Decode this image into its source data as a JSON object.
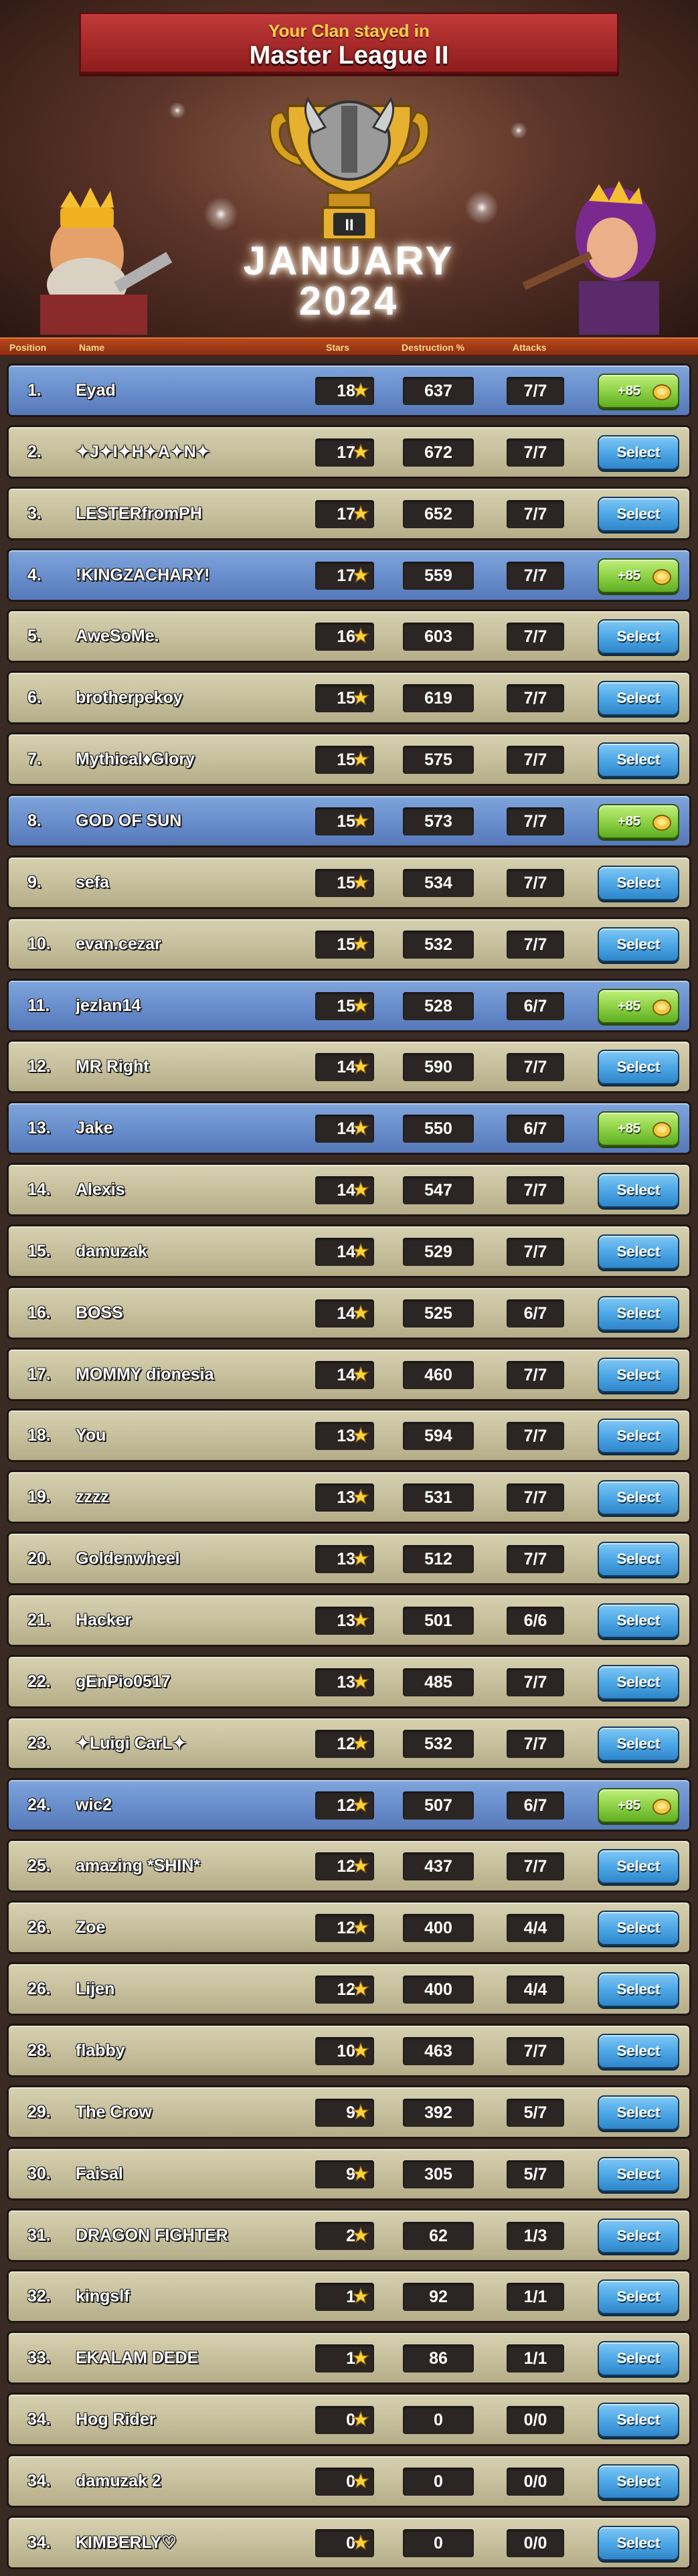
{
  "banner": {
    "subtitle": "Your Clan stayed in",
    "title": "Master League II"
  },
  "trophy": {
    "level": "II"
  },
  "season": {
    "month": "JANUARY",
    "year": "2024"
  },
  "columns": {
    "position": "Position",
    "name": "Name",
    "stars": "Stars",
    "destruction": "Destruction %",
    "attacks": "Attacks"
  },
  "colors": {
    "clan_row": "#6a8fcd",
    "other_row": "#c7c09d",
    "select_button": "#4ea8e6",
    "bonus_button": "#8fd247"
  },
  "buttons": {
    "select": "Select",
    "bonus": "+85"
  },
  "rows": [
    {
      "pos": "1.",
      "name": "Eyad",
      "stars": "18",
      "destruction": "637",
      "attacks": "7/7",
      "clan": true
    },
    {
      "pos": "2.",
      "name": "✦J✦I✦H✦A✦N✦",
      "stars": "17",
      "destruction": "672",
      "attacks": "7/7",
      "clan": false
    },
    {
      "pos": "3.",
      "name": "LESTERfromPH",
      "stars": "17",
      "destruction": "652",
      "attacks": "7/7",
      "clan": false
    },
    {
      "pos": "4.",
      "name": "!KINGZACHARY!",
      "stars": "17",
      "destruction": "559",
      "attacks": "7/7",
      "clan": true
    },
    {
      "pos": "5.",
      "name": "AweSoMe.",
      "stars": "16",
      "destruction": "603",
      "attacks": "7/7",
      "clan": false
    },
    {
      "pos": "6.",
      "name": "brotherpekoy",
      "stars": "15",
      "destruction": "619",
      "attacks": "7/7",
      "clan": false
    },
    {
      "pos": "7.",
      "name": "Mythical♦Glory",
      "stars": "15",
      "destruction": "575",
      "attacks": "7/7",
      "clan": false
    },
    {
      "pos": "8.",
      "name": "GOD OF SUN",
      "stars": "15",
      "destruction": "573",
      "attacks": "7/7",
      "clan": true
    },
    {
      "pos": "9.",
      "name": "sefa",
      "stars": "15",
      "destruction": "534",
      "attacks": "7/7",
      "clan": false
    },
    {
      "pos": "10.",
      "name": "evan.cezar",
      "stars": "15",
      "destruction": "532",
      "attacks": "7/7",
      "clan": false
    },
    {
      "pos": "11.",
      "name": "jezlan14",
      "stars": "15",
      "destruction": "528",
      "attacks": "6/7",
      "clan": true
    },
    {
      "pos": "12.",
      "name": "MR Right",
      "stars": "14",
      "destruction": "590",
      "attacks": "7/7",
      "clan": false
    },
    {
      "pos": "13.",
      "name": "Jake",
      "stars": "14",
      "destruction": "550",
      "attacks": "6/7",
      "clan": true
    },
    {
      "pos": "14.",
      "name": "Alexis",
      "stars": "14",
      "destruction": "547",
      "attacks": "7/7",
      "clan": false
    },
    {
      "pos": "15.",
      "name": "damuzak",
      "stars": "14",
      "destruction": "529",
      "attacks": "7/7",
      "clan": false
    },
    {
      "pos": "16.",
      "name": "BOSS",
      "stars": "14",
      "destruction": "525",
      "attacks": "6/7",
      "clan": false
    },
    {
      "pos": "17.",
      "name": "MOMMY dionesia",
      "stars": "14",
      "destruction": "460",
      "attacks": "7/7",
      "clan": false
    },
    {
      "pos": "18.",
      "name": "You",
      "stars": "13",
      "destruction": "594",
      "attacks": "7/7",
      "clan": false
    },
    {
      "pos": "19.",
      "name": "zzzz",
      "stars": "13",
      "destruction": "531",
      "attacks": "7/7",
      "clan": false
    },
    {
      "pos": "20.",
      "name": "Goldenwheel",
      "stars": "13",
      "destruction": "512",
      "attacks": "7/7",
      "clan": false
    },
    {
      "pos": "21.",
      "name": "Hacker",
      "stars": "13",
      "destruction": "501",
      "attacks": "6/6",
      "clan": false
    },
    {
      "pos": "22.",
      "name": "gEnPio0517",
      "stars": "13",
      "destruction": "485",
      "attacks": "7/7",
      "clan": false
    },
    {
      "pos": "23.",
      "name": "✦Luigi CarL✦",
      "stars": "12",
      "destruction": "532",
      "attacks": "7/7",
      "clan": false
    },
    {
      "pos": "24.",
      "name": "wic2",
      "stars": "12",
      "destruction": "507",
      "attacks": "6/7",
      "clan": true
    },
    {
      "pos": "25.",
      "name": "amazing *SHIN*",
      "stars": "12",
      "destruction": "437",
      "attacks": "7/7",
      "clan": false
    },
    {
      "pos": "26.",
      "name": "Zoe",
      "stars": "12",
      "destruction": "400",
      "attacks": "4/4",
      "clan": false
    },
    {
      "pos": "26.",
      "name": "Lijen",
      "stars": "12",
      "destruction": "400",
      "attacks": "4/4",
      "clan": false
    },
    {
      "pos": "28.",
      "name": "flabby",
      "stars": "10",
      "destruction": "463",
      "attacks": "7/7",
      "clan": false
    },
    {
      "pos": "29.",
      "name": "The Crow",
      "stars": "9",
      "destruction": "392",
      "attacks": "5/7",
      "clan": false
    },
    {
      "pos": "30.",
      "name": "Faisal",
      "stars": "9",
      "destruction": "305",
      "attacks": "5/7",
      "clan": false
    },
    {
      "pos": "31.",
      "name": "DRAGON FIGHTER",
      "stars": "2",
      "destruction": "62",
      "attacks": "1/3",
      "clan": false
    },
    {
      "pos": "32.",
      "name": "kingslf",
      "stars": "1",
      "destruction": "92",
      "attacks": "1/1",
      "clan": false
    },
    {
      "pos": "33.",
      "name": "EKALAM DEDE",
      "stars": "1",
      "destruction": "86",
      "attacks": "1/1",
      "clan": false
    },
    {
      "pos": "34.",
      "name": "Hog Rider",
      "stars": "0",
      "destruction": "0",
      "attacks": "0/0",
      "clan": false
    },
    {
      "pos": "34.",
      "name": "damuzak 2",
      "stars": "0",
      "destruction": "0",
      "attacks": "0/0",
      "clan": false
    },
    {
      "pos": "34.",
      "name": "KIMBERLY♡",
      "stars": "0",
      "destruction": "0",
      "attacks": "0/0",
      "clan": false
    }
  ]
}
